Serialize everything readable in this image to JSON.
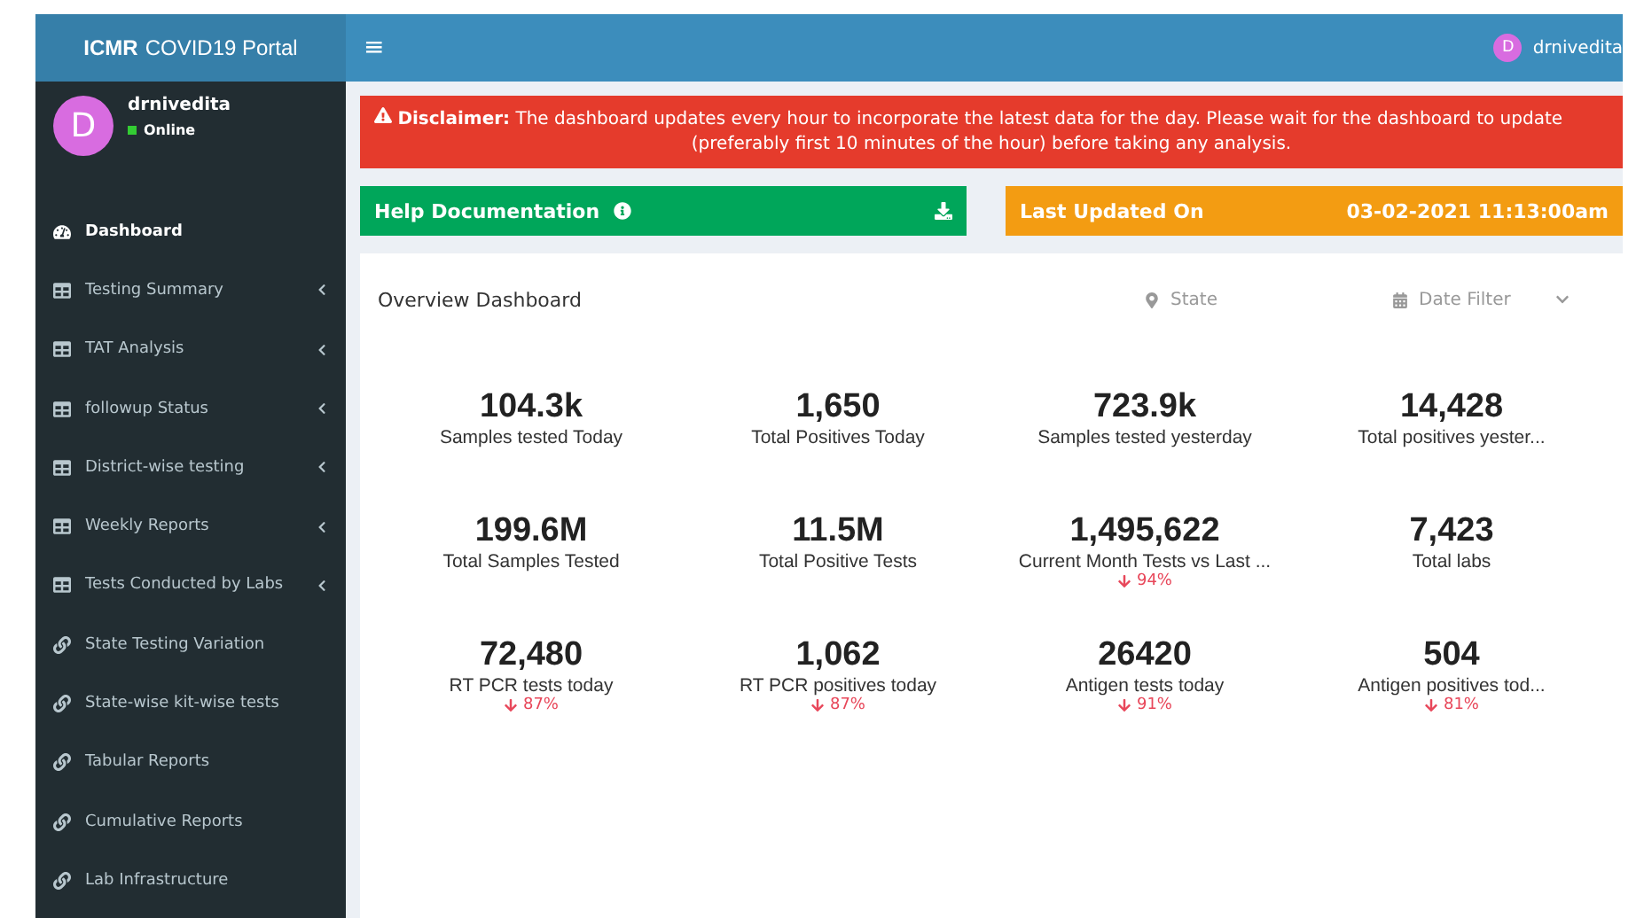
{
  "header": {
    "logo_bold": "ICMR",
    "logo_rest": "COVID19 Portal",
    "menu_glyph": "≡",
    "user": {
      "initial": "D",
      "name": "drnivedita"
    }
  },
  "sidebar": {
    "user": {
      "initial": "D",
      "name": "drnivedita",
      "status": "Online"
    },
    "items": [
      {
        "label": "Dashboard",
        "kind": "dashboard",
        "selected": true,
        "has_children": false
      },
      {
        "label": "Testing Summary",
        "kind": "table",
        "selected": false,
        "has_children": true
      },
      {
        "label": "TAT Analysis",
        "kind": "table",
        "selected": false,
        "has_children": true
      },
      {
        "label": "followup Status",
        "kind": "table",
        "selected": false,
        "has_children": true
      },
      {
        "label": "District-wise testing",
        "kind": "table",
        "selected": false,
        "has_children": true
      },
      {
        "label": "Weekly Reports",
        "kind": "table",
        "selected": false,
        "has_children": true
      },
      {
        "label": "Tests Conducted by Labs",
        "kind": "table",
        "selected": false,
        "has_children": true
      },
      {
        "label": "State Testing Variation",
        "kind": "link",
        "selected": false,
        "has_children": false
      },
      {
        "label": "State-wise kit-wise tests",
        "kind": "link",
        "selected": false,
        "has_children": false
      },
      {
        "label": "Tabular Reports",
        "kind": "link",
        "selected": false,
        "has_children": false
      },
      {
        "label": "Cumulative Reports",
        "kind": "link",
        "selected": false,
        "has_children": false
      },
      {
        "label": "Lab Infrastructure",
        "kind": "link",
        "selected": false,
        "has_children": false
      }
    ]
  },
  "disclaimer": {
    "label": "Disclaimer:",
    "text": "The dashboard updates every hour to incorporate the latest data for the day. Please wait for the dashboard to update",
    "text2": "(preferably first 10 minutes of the hour) before taking any analysis."
  },
  "help": {
    "label": "Help Documentation"
  },
  "last_updated": {
    "label": "Last Updated On",
    "value": "03-02-2021 11:13:00am"
  },
  "overview": {
    "title": "Overview Dashboard",
    "state_placeholder": "State",
    "date_placeholder": "Date Filter"
  },
  "stat_rows": [
    [
      {
        "value": "104.3k",
        "label": "Samples tested Today"
      },
      {
        "value": "1,650",
        "label": "Total Positives Today"
      },
      {
        "value": "723.9k",
        "label": "Samples tested yesterday"
      },
      {
        "value": "14,428",
        "label": "Total positives yester..."
      }
    ],
    [
      {
        "value": "199.6M",
        "label": "Total Samples Tested"
      },
      {
        "value": "11.5M",
        "label": "Total Positive Tests"
      },
      {
        "value": "1,495,622",
        "label": "Current Month Tests vs Last ...",
        "trend": "94%"
      },
      {
        "value": "7,423",
        "label": "Total labs"
      }
    ],
    [
      {
        "value": "72,480",
        "label": "RT PCR tests today",
        "trend": "87%"
      },
      {
        "value": "1,062",
        "label": "RT PCR positives today",
        "trend": "87%"
      },
      {
        "value": "26420",
        "label": "Antigen tests today",
        "trend": "91%"
      },
      {
        "value": "504",
        "label": "Antigen positives tod...",
        "trend": "81%"
      }
    ]
  ]
}
